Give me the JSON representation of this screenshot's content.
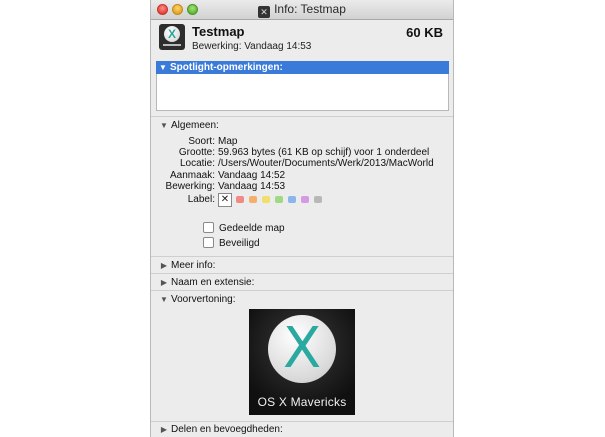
{
  "window": {
    "title": "Info: Testmap"
  },
  "header": {
    "name": "Testmap",
    "size": "60 KB",
    "edited": "Bewerking:  Vandaag 14:53"
  },
  "spotlight": {
    "label": "Spotlight-opmerkingen:",
    "value": ""
  },
  "sections": {
    "general": "Algemeen:",
    "more_info": "Meer info:",
    "name_ext": "Naam en extensie:",
    "preview": "Voorvertoning:",
    "sharing": "Delen en bevoegdheden:"
  },
  "general": {
    "rows": [
      {
        "key": "Soort:",
        "value": "Map"
      },
      {
        "key": "Grootte:",
        "value": "59.963 bytes (61 KB op schijf) voor 1 onderdeel"
      },
      {
        "key": "Locatie:",
        "value": "/Users/Wouter/Documents/Werk/2013/MacWorld"
      },
      {
        "key": "Aanmaak:",
        "value": "Vandaag 14:52"
      },
      {
        "key": "Bewerking:",
        "value": "Vandaag 14:53"
      }
    ],
    "label_key": "Label:",
    "label_none": "✕",
    "swatches": [
      "#f08a83",
      "#f4b06a",
      "#f0df6a",
      "#9fd983",
      "#8bb6ec",
      "#d49be3",
      "#b8b8b8"
    ],
    "shared_folder": "Gedeelde map",
    "locked": "Beveiligd"
  },
  "preview": {
    "caption": "OS X Mavericks"
  },
  "icons": {
    "expanded": "▼",
    "collapsed": "▶"
  }
}
